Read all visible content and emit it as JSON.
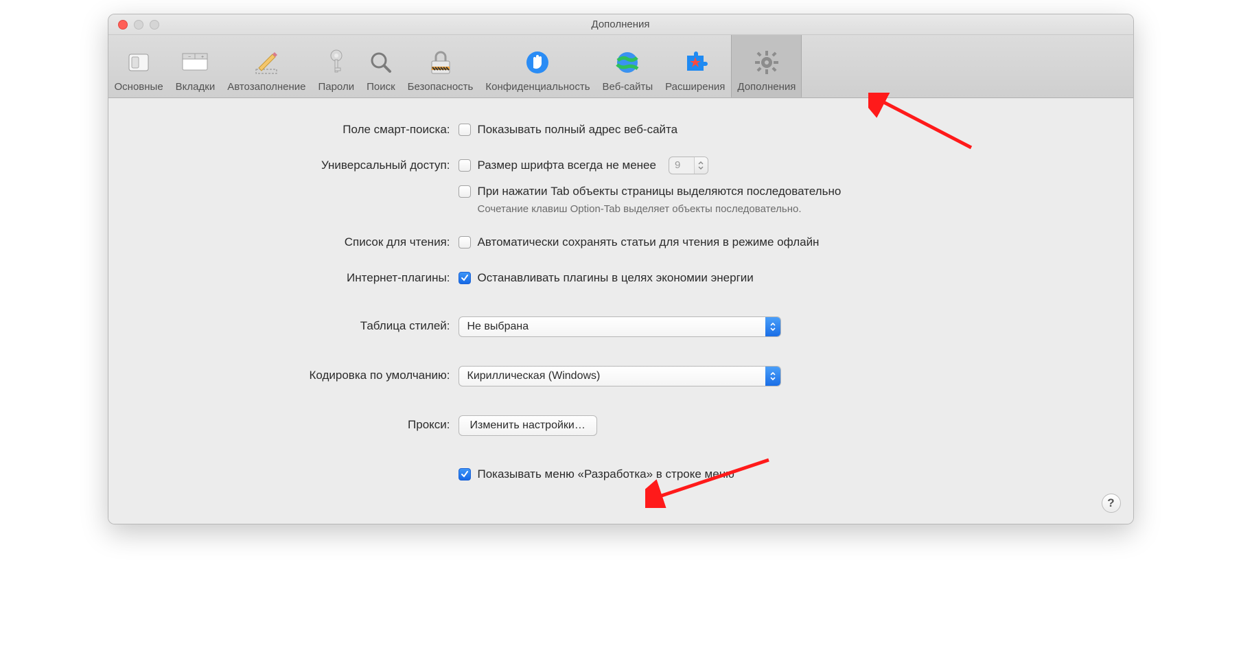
{
  "window": {
    "title": "Дополнения"
  },
  "toolbar": {
    "items": [
      {
        "label": "Основные"
      },
      {
        "label": "Вкладки"
      },
      {
        "label": "Автозаполнение"
      },
      {
        "label": "Пароли"
      },
      {
        "label": "Поиск"
      },
      {
        "label": "Безопасность"
      },
      {
        "label": "Конфиденциальность"
      },
      {
        "label": "Веб-сайты"
      },
      {
        "label": "Расширения"
      },
      {
        "label": "Дополнения"
      }
    ],
    "selected_index": 9
  },
  "sections": {
    "smart_search": {
      "label": "Поле смарт-поиска:",
      "checkbox_label": "Показывать полный адрес веб-сайта",
      "checked": false
    },
    "accessibility": {
      "label": "Универсальный доступ:",
      "font_checkbox_label": "Размер шрифта всегда не менее",
      "font_checked": false,
      "font_size_value": "9",
      "tab_checkbox_label": "При нажатии Tab объекты страницы выделяются последовательно",
      "tab_checked": false,
      "tab_hint": "Сочетание клавиш Option-Tab выделяет объекты последовательно."
    },
    "reading_list": {
      "label": "Список для чтения:",
      "checkbox_label": "Автоматически сохранять статьи для чтения в режиме офлайн",
      "checked": false
    },
    "plugins": {
      "label": "Интернет-плагины:",
      "checkbox_label": "Останавливать плагины в целях экономии энергии",
      "checked": true
    },
    "stylesheet": {
      "label": "Таблица стилей:",
      "value": "Не выбрана"
    },
    "encoding": {
      "label": "Кодировка по умолчанию:",
      "value": "Кириллическая (Windows)"
    },
    "proxy": {
      "label": "Прокси:",
      "button": "Изменить настройки…"
    },
    "develop": {
      "checkbox_label": "Показывать меню «Разработка» в строке меню",
      "checked": true
    }
  },
  "help_label": "?"
}
